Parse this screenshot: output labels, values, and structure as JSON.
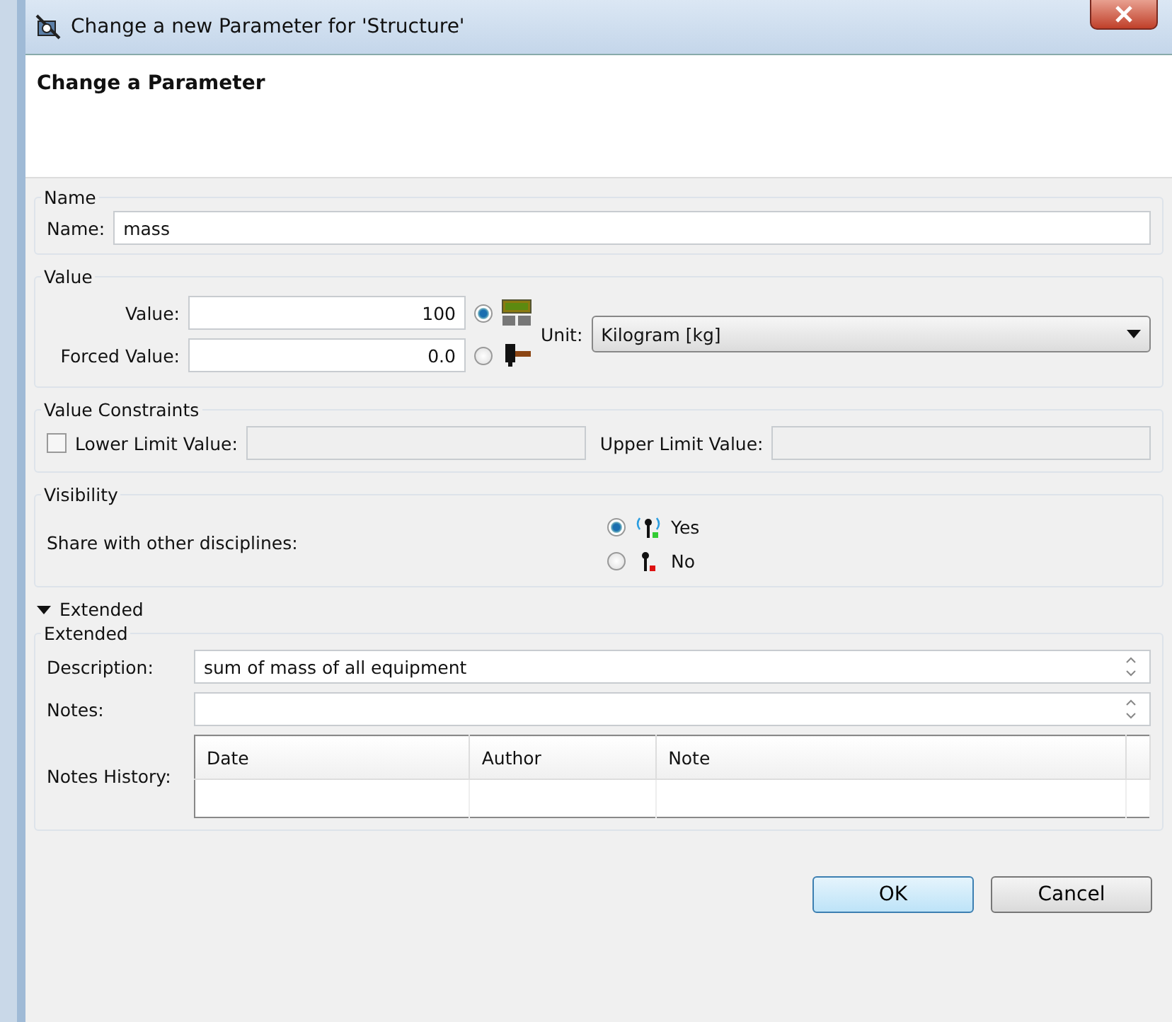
{
  "window": {
    "title": "Change a new Parameter for 'Structure'"
  },
  "header": {
    "title": "Change a Parameter"
  },
  "name_group": {
    "legend": "Name",
    "label": "Name:",
    "value": "mass"
  },
  "value_group": {
    "legend": "Value",
    "value_label": "Value:",
    "value": "100",
    "forced_label": "Forced Value:",
    "forced_value": "0.0",
    "sources": [
      {
        "selected": true
      },
      {
        "selected": false
      }
    ],
    "unit_label": "Unit:",
    "unit": "Kilogram [kg]"
  },
  "constraints": {
    "legend": "Value Constraints",
    "lower_checked": false,
    "lower_label": "Lower Limit Value:",
    "upper_label": "Upper Limit Value:"
  },
  "visibility": {
    "legend": "Visibility",
    "label": "Share with other disciplines:",
    "options": [
      {
        "label": "Yes",
        "selected": true
      },
      {
        "label": "No",
        "selected": false
      }
    ]
  },
  "extended": {
    "toggle_label": "Extended",
    "expanded": true,
    "legend": "Extended",
    "description_label": "Description:",
    "description": "sum of mass of all equipment",
    "notes_label": "Notes:",
    "history_label": "Notes History:",
    "columns": [
      "Date",
      "Author",
      "Note"
    ]
  },
  "buttons": [
    {
      "label": "OK",
      "default": true
    },
    {
      "label": "Cancel",
      "default": false
    }
  ]
}
